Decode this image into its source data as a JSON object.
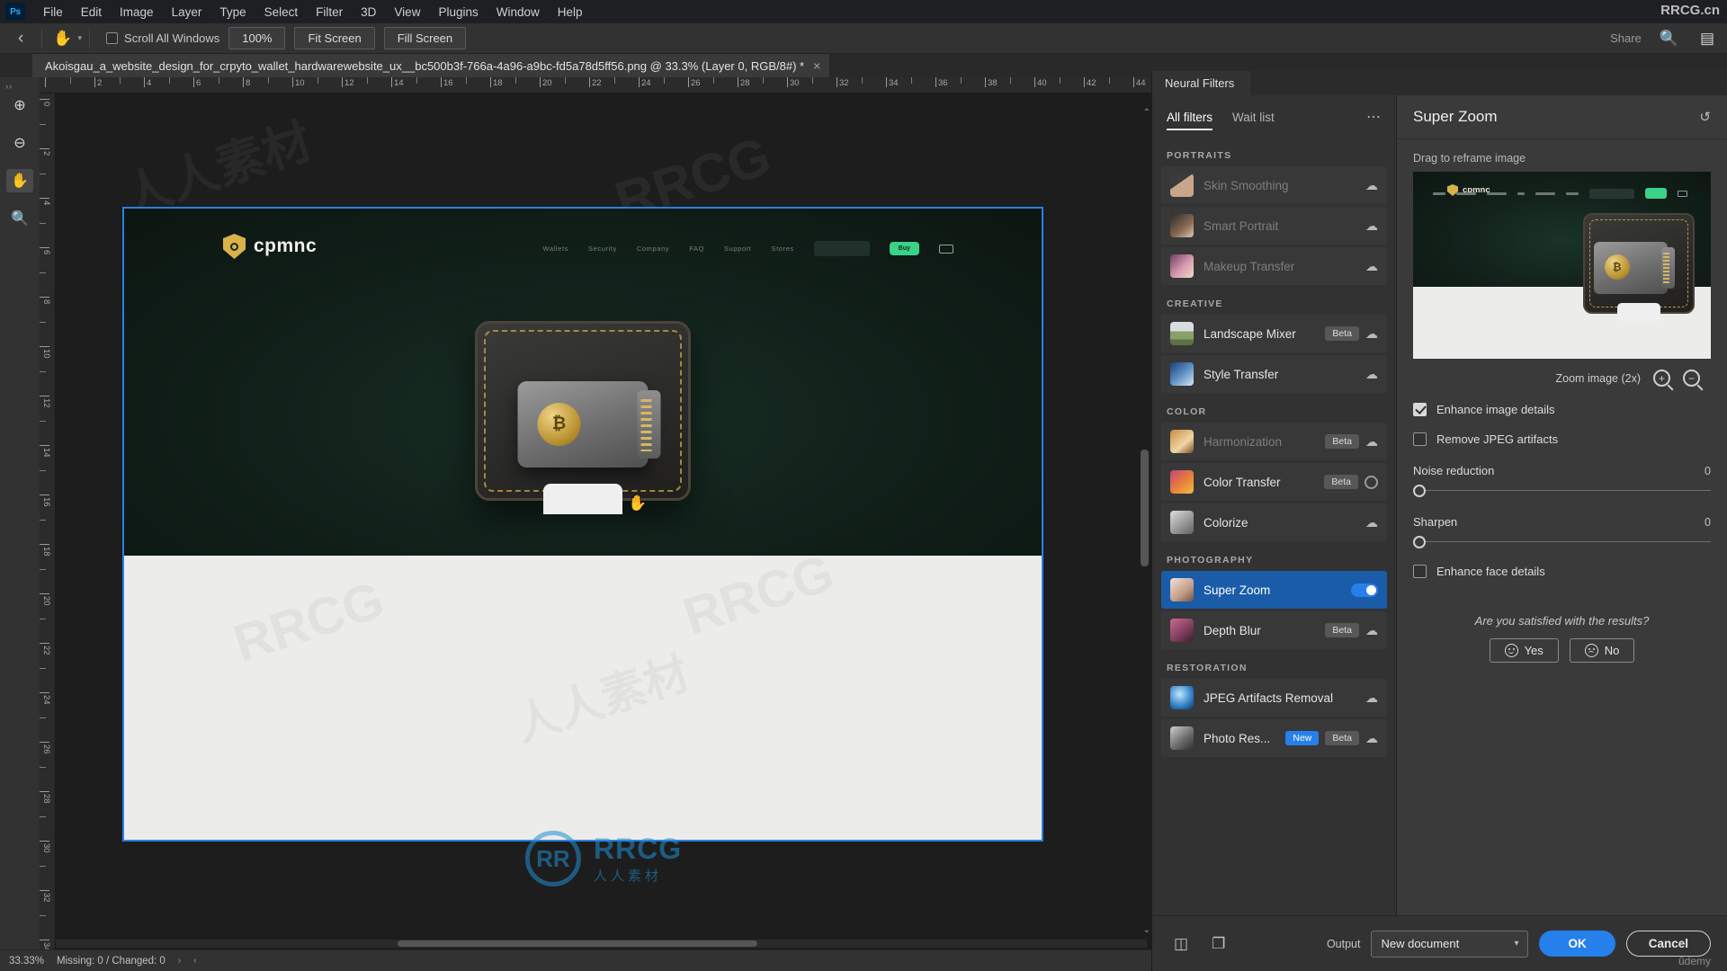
{
  "app": {
    "logo": "Ps",
    "brand_watermark": "RRCG.cn",
    "menus": [
      "File",
      "Edit",
      "Image",
      "Layer",
      "Type",
      "Select",
      "Filter",
      "3D",
      "View",
      "Plugins",
      "Window",
      "Help"
    ]
  },
  "options_bar": {
    "back_icon": "chevron-left",
    "tool_icon": "hand-tool",
    "scroll_all_windows_label": "Scroll All Windows",
    "scroll_all_windows_checked": false,
    "zoom_100_label": "100%",
    "fit_screen_label": "Fit Screen",
    "fill_screen_label": "Fill Screen",
    "share_label": "Share"
  },
  "document": {
    "tab_title": "Akoisgau_a_website_design_for_crpyto_wallet_hardwarewebsite_ux__bc500b3f-766a-4a96-a9bc-fd5a78d5ff56.png @ 33.3% (Layer 0, RGB/8#) *",
    "close_glyph": "×"
  },
  "toolbar": {
    "items": [
      {
        "name": "zoom-in-tool",
        "glyph": "⊕"
      },
      {
        "name": "zoom-out-tool",
        "glyph": "⊖"
      },
      {
        "name": "hand-tool",
        "glyph": "✋"
      },
      {
        "name": "zoom-tool",
        "glyph": "🔍"
      }
    ]
  },
  "rulers": {
    "top_labels": [
      "2",
      "4",
      "6",
      "8",
      "10",
      "12",
      "14",
      "16",
      "18",
      "20",
      "22",
      "24",
      "26",
      "28",
      "30",
      "32",
      "34",
      "36",
      "38",
      "40",
      "42",
      "44"
    ],
    "left_labels": [
      "0",
      "2",
      "4",
      "6",
      "8",
      "10",
      "12",
      "14",
      "16",
      "18",
      "20",
      "22",
      "24",
      "26",
      "28",
      "30",
      "32"
    ]
  },
  "artboard": {
    "brand": "cpmnc",
    "nav_links": [
      "Wallets",
      "Security",
      "Company",
      "FAQ",
      "Support",
      "Stores"
    ],
    "cta_label": "Buy",
    "cursor": "hand-cursor"
  },
  "watermarks": {
    "cn_text": "人人素材",
    "rrcg_text": "RRCG",
    "center_mark": "RR",
    "center_title": "RRCG",
    "center_subtitle": "人人素材"
  },
  "neural_filters": {
    "panel_tab": "Neural Filters",
    "tabs": [
      {
        "label": "All filters",
        "active": true
      },
      {
        "label": "Wait list",
        "active": false
      }
    ],
    "overflow_glyph": "⋯",
    "groups": [
      {
        "title": "PORTRAITS",
        "filters": [
          {
            "name": "Skin Smoothing",
            "thumb": "t-skin",
            "disabled": true,
            "badge": "",
            "right": "cloud",
            "selected": false
          },
          {
            "name": "Smart Portrait",
            "thumb": "t-smart",
            "disabled": true,
            "badge": "",
            "right": "cloud",
            "selected": false
          },
          {
            "name": "Makeup Transfer",
            "thumb": "t-makeup",
            "disabled": true,
            "badge": "",
            "right": "cloud",
            "selected": false
          }
        ]
      },
      {
        "title": "CREATIVE",
        "filters": [
          {
            "name": "Landscape Mixer",
            "thumb": "t-landscape",
            "disabled": false,
            "badge": "Beta",
            "right": "cloud",
            "selected": false
          },
          {
            "name": "Style Transfer",
            "thumb": "t-style",
            "disabled": false,
            "badge": "",
            "right": "cloud",
            "selected": false
          }
        ]
      },
      {
        "title": "COLOR",
        "filters": [
          {
            "name": "Harmonization",
            "thumb": "t-harmon",
            "disabled": true,
            "badge": "Beta",
            "right": "cloud",
            "selected": false
          },
          {
            "name": "Color Transfer",
            "thumb": "t-colortr",
            "disabled": false,
            "badge": "Beta",
            "right": "ring",
            "selected": false
          },
          {
            "name": "Colorize",
            "thumb": "t-colorize",
            "disabled": false,
            "badge": "",
            "right": "cloud",
            "selected": false
          }
        ]
      },
      {
        "title": "PHOTOGRAPHY",
        "filters": [
          {
            "name": "Super Zoom",
            "thumb": "t-superzoom",
            "disabled": false,
            "badge": "",
            "right": "toggle-on",
            "selected": true
          },
          {
            "name": "Depth Blur",
            "thumb": "t-depth",
            "disabled": false,
            "badge": "Beta",
            "right": "cloud",
            "selected": false
          }
        ]
      },
      {
        "title": "RESTORATION",
        "filters": [
          {
            "name": "JPEG Artifacts Removal",
            "thumb": "t-jpeg",
            "disabled": false,
            "badge": "",
            "right": "cloud",
            "selected": false
          },
          {
            "name": "Photo Res...",
            "thumb": "t-photores",
            "disabled": false,
            "badge": "Beta",
            "badge_new": "New",
            "right": "cloud",
            "selected": false
          }
        ]
      }
    ],
    "detail": {
      "title": "Super Zoom",
      "reset_icon": "reset-icon",
      "reframe_label": "Drag to reframe image",
      "zoom_image_label": "Zoom image (2x)",
      "zoom_in_icon": "zoom-in-icon",
      "zoom_out_icon": "zoom-out-icon",
      "checkboxes": [
        {
          "label": "Enhance image details",
          "checked": true
        },
        {
          "label": "Remove JPEG artifacts",
          "checked": false
        }
      ],
      "sliders": [
        {
          "label": "Noise reduction",
          "value": "0",
          "percent": 0
        },
        {
          "label": "Sharpen",
          "value": "0",
          "percent": 0
        }
      ],
      "face_details": {
        "label": "Enhance face details",
        "checked": false
      },
      "satisfaction_question": "Are you satisfied with the results?",
      "yes_label": "Yes",
      "no_label": "No"
    },
    "footer": {
      "compare_icon": "split-view-icon",
      "layers_icon": "layers-icon",
      "output_label": "Output",
      "output_value": "New document",
      "ok_label": "OK",
      "cancel_label": "Cancel",
      "corner_mark": "ûdemy"
    }
  },
  "status_bar": {
    "zoom": "33.33%",
    "info": "Missing: 0 / Changed: 0",
    "right_arrow": "›",
    "left_arrow": "‹"
  }
}
